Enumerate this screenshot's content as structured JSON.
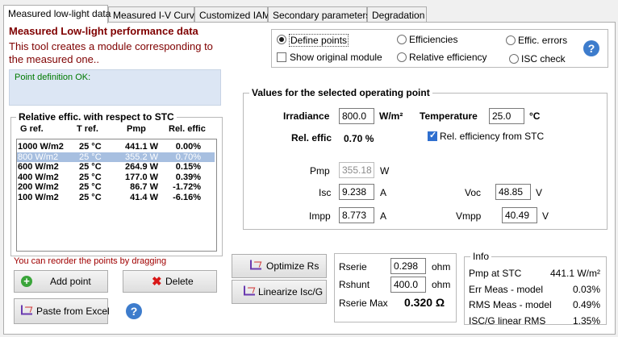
{
  "tabs": [
    "Measured low-light data",
    "Measured I-V Curve",
    "Customized IAM",
    "Secondary parameters",
    "Degradation"
  ],
  "header": {
    "title": "Measured Low-light performance data",
    "description": "This tool creates a module corresponding to the measured one..",
    "status": "Point definition OK:"
  },
  "options": {
    "define_points": "Define points",
    "show_original": "Show original module",
    "efficiencies": "Efficiencies",
    "relative_efficiency": "Relative efficiency",
    "effic_errors": "Effic. errors",
    "isc_check": "ISC check"
  },
  "table": {
    "group_title": "Relative effic. with respect to STC",
    "columns": [
      "G ref.",
      "T ref.",
      "Pmp",
      "Rel. effic"
    ],
    "rows": [
      [
        "1000 W/m2",
        "25 °C",
        "441.1 W",
        "0.00%"
      ],
      [
        "800 W/m2",
        "25 °C",
        "355.2 W",
        "0.70%"
      ],
      [
        "600 W/m2",
        "25 °C",
        "264.9 W",
        "0.15%"
      ],
      [
        "400 W/m2",
        "25 °C",
        "177.0 W",
        "0.39%"
      ],
      [
        "200 W/m2",
        "25 °C",
        "86.7 W",
        "-1.72%"
      ],
      [
        "100 W/m2",
        "25 °C",
        "41.4 W",
        "-6.16%"
      ]
    ],
    "selected_row": 1,
    "reorder_hint": "You can reorder the points by dragging"
  },
  "buttons": {
    "add_point": "Add point",
    "delete": "Delete",
    "paste_excel": "Paste from Excel",
    "optimize_rs": "Optimize Rs",
    "linearize": "Linearize Isc/G"
  },
  "operating_point": {
    "group_title": "Values for the selected operating point",
    "irradiance_label": "Irradiance",
    "irradiance_value": "800.0",
    "irradiance_unit": "W/m²",
    "temperature_label": "Temperature",
    "temperature_value": "25.0",
    "temperature_unit": "°C",
    "rel_effic_label": "Rel. effic",
    "rel_effic_value": "0.70 %",
    "rel_from_stc": "Rel. efficiency from STC",
    "pmp_label": "Pmp",
    "pmp_value": "355.18",
    "pmp_unit": "W",
    "isc_label": "Isc",
    "isc_value": "9.238",
    "isc_unit": "A",
    "impp_label": "Impp",
    "impp_value": "8.773",
    "impp_unit": "A",
    "voc_label": "Voc",
    "voc_value": "48.85",
    "voc_unit": "V",
    "vmpp_label": "Vmpp",
    "vmpp_value": "40.49",
    "vmpp_unit": "V"
  },
  "resist": {
    "rserie_label": "Rserie",
    "rserie_value": "0.298",
    "rserie_unit": "ohm",
    "rshunt_label": "Rshunt",
    "rshunt_value": "400.0",
    "rshunt_unit": "ohm",
    "rseriemax_label": "Rserie Max",
    "rseriemax_value": "0.320 Ω"
  },
  "info": {
    "title": "Info",
    "rows": [
      [
        "Pmp at STC",
        "441.1 W/m²"
      ],
      [
        "Err Meas - model",
        "0.03%"
      ],
      [
        "RMS Meas - model",
        "0.49%"
      ],
      [
        "ISC/G linear RMS",
        "1.35%"
      ]
    ]
  }
}
